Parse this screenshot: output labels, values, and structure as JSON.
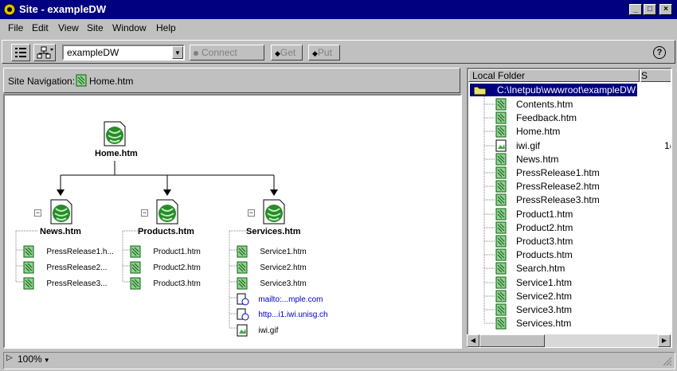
{
  "window": {
    "title": "Site - exampleDW",
    "minimize": "_",
    "maximize": "□",
    "close": "×"
  },
  "menu": [
    "File",
    "Edit",
    "View",
    "Site",
    "Window",
    "Help"
  ],
  "toolbar": {
    "site_value": "exampleDW",
    "connect_label": "Connect",
    "get_label": "Get",
    "put_label": "Put",
    "help_label": "?"
  },
  "site_nav": {
    "label": "Site Navigation:",
    "file": "Home.htm"
  },
  "site_map": {
    "root": "Home.htm",
    "sections": [
      {
        "title": "News.htm",
        "children": [
          "PressRelease1.h...",
          "PressRelease2...",
          "PressRelease3..."
        ]
      },
      {
        "title": "Products.htm",
        "children": [
          "Product1.htm",
          "Product2.htm",
          "Product3.htm"
        ]
      },
      {
        "title": "Services.htm",
        "children": [
          "Service1.htm",
          "Service2.htm",
          "Service3.htm",
          "mailto:...mple.com",
          "http...i1.iwi.unisg.ch",
          "iwi.gif"
        ]
      }
    ]
  },
  "local_folder": {
    "header": "Local Folder",
    "header2": "S",
    "root": "C:\\Inetpub\\wwwroot\\exampleDW",
    "files": [
      "Contents.htm",
      "Feedback.htm",
      "Home.htm",
      "iwi.gif",
      "News.htm",
      "PressRelease1.htm",
      "PressRelease2.htm",
      "PressRelease3.htm",
      "Product1.htm",
      "Product2.htm",
      "Product3.htm",
      "Products.htm",
      "Search.htm",
      "Service1.htm",
      "Service2.htm",
      "Service3.htm",
      "Services.htm"
    ],
    "iwi_size": "1("
  },
  "status": {
    "zoom": "100%"
  }
}
